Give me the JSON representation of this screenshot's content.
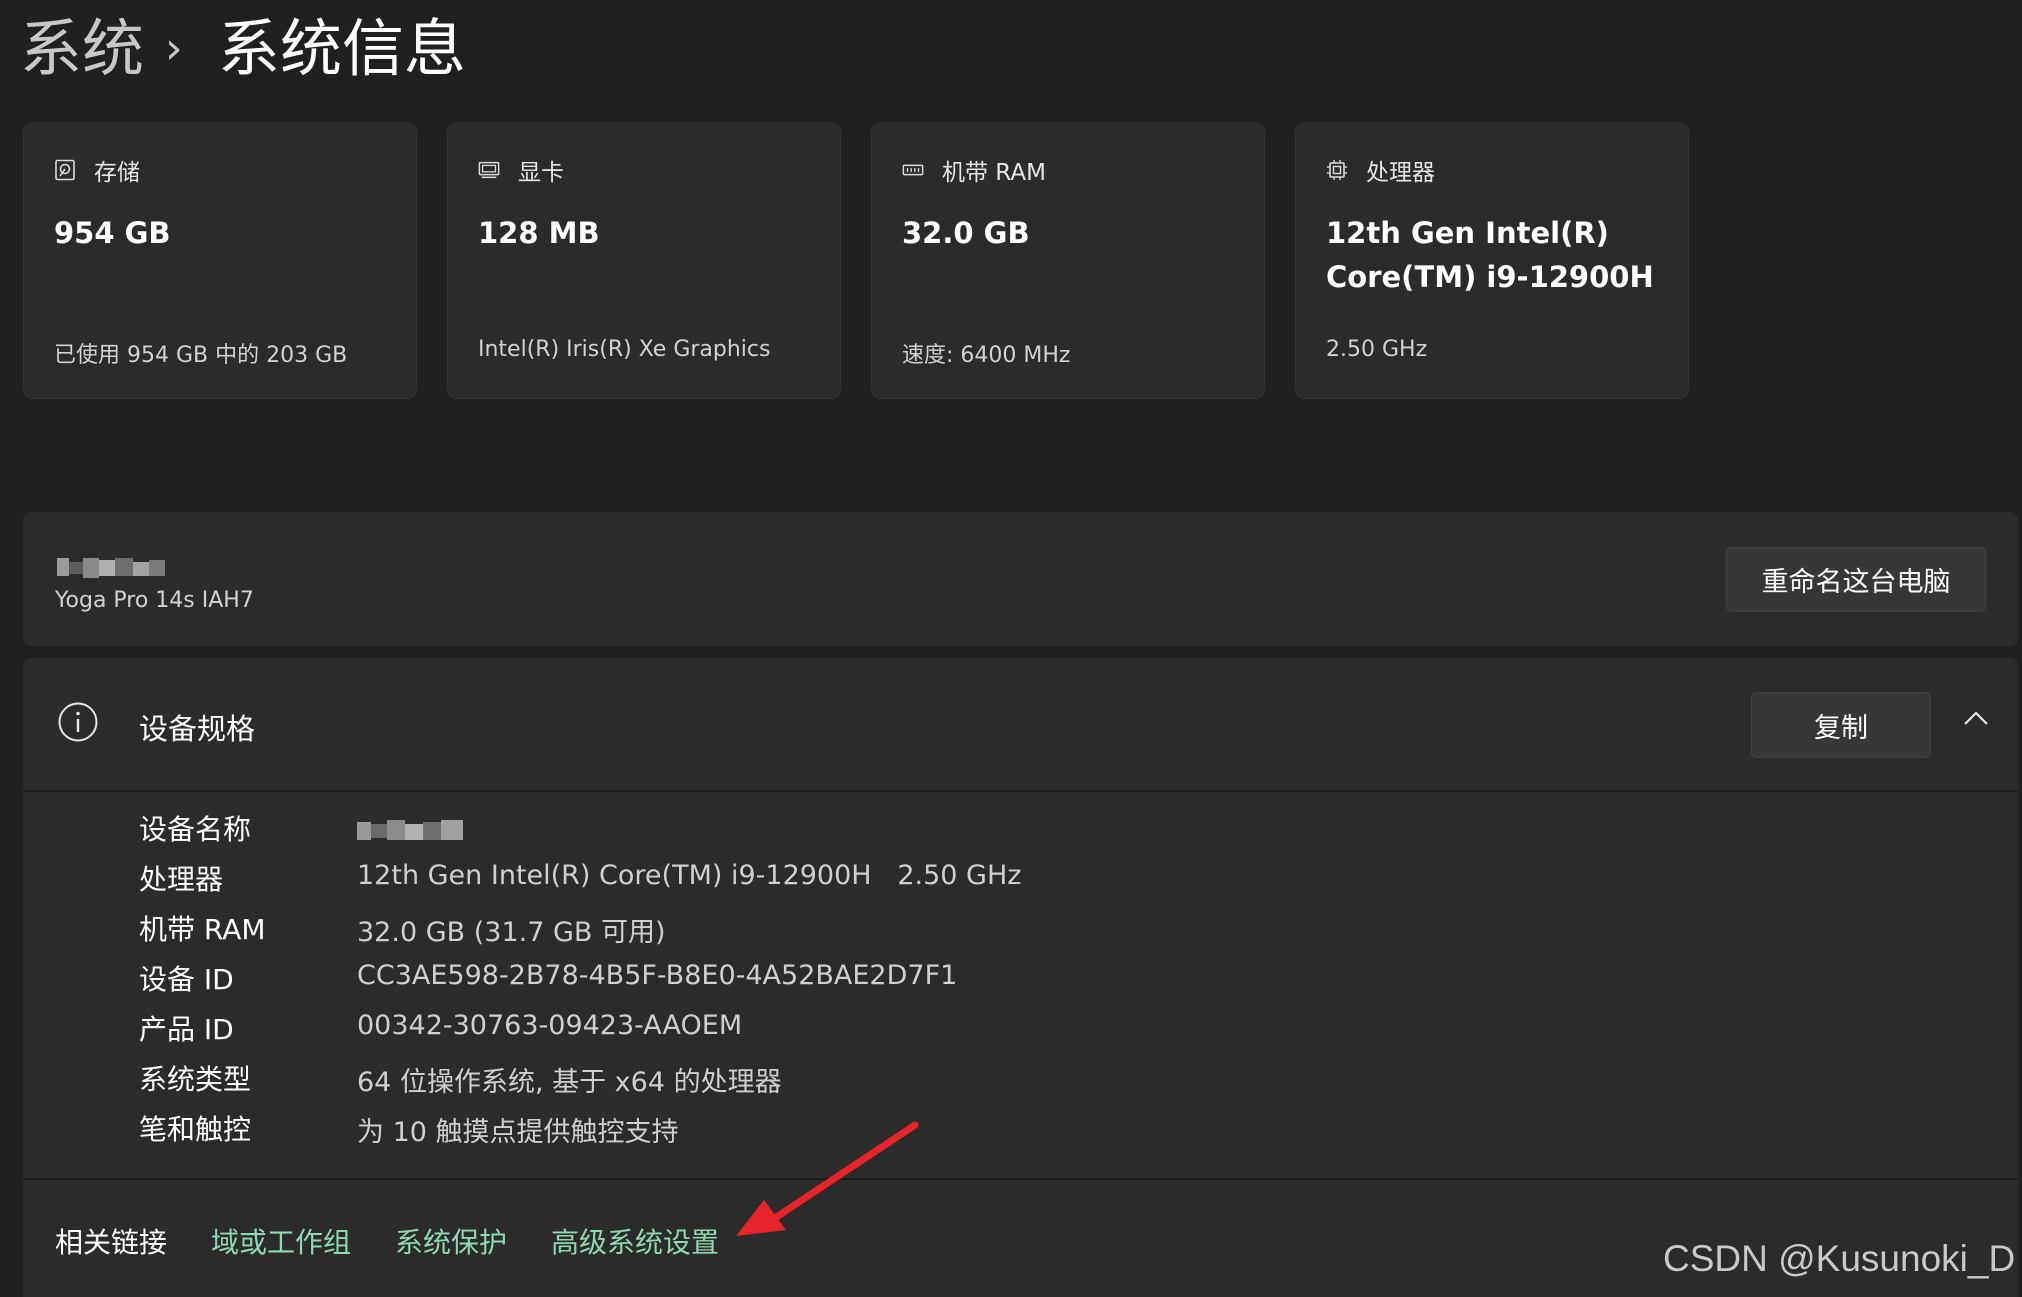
{
  "breadcrumb": {
    "root": "系统",
    "separator": "›",
    "current": "系统信息"
  },
  "cards": [
    {
      "icon": "storage-icon",
      "label": "存储",
      "value": "954 GB",
      "sub": "已使用 954 GB 中的 203 GB"
    },
    {
      "icon": "display-adapter-icon",
      "label": "显卡",
      "value": "128 MB",
      "sub": "Intel(R) Iris(R) Xe Graphics"
    },
    {
      "icon": "ram-icon",
      "label": "机带 RAM",
      "value": "32.0 GB",
      "sub": "速度: 6400 MHz"
    },
    {
      "icon": "processor-icon",
      "label": "处理器",
      "value": "12th Gen Intel(R) Core(TM) i9-12900H",
      "sub": "2.50 GHz"
    }
  ],
  "computer": {
    "model": "Yoga Pro 14s IAH7",
    "rename_label": "重命名这台电脑"
  },
  "device_specs": {
    "title": "设备规格",
    "copy_label": "复制",
    "rows": [
      {
        "key": "设备名称",
        "value": ""
      },
      {
        "key": "处理器",
        "value": "12th Gen Intel(R) Core(TM) i9-12900H   2.50 GHz"
      },
      {
        "key": "机带 RAM",
        "value": "32.0 GB (31.7 GB 可用)"
      },
      {
        "key": "设备 ID",
        "value": "CC3AE598-2B78-4B5F-B8E0-4A52BAE2D7F1"
      },
      {
        "key": "产品 ID",
        "value": "00342-30763-09423-AAOEM"
      },
      {
        "key": "系统类型",
        "value": "64 位操作系统, 基于 x64 的处理器"
      },
      {
        "key": "笔和触控",
        "value": "为 10 触摸点提供触控支持"
      }
    ]
  },
  "related_links": {
    "label": "相关链接",
    "links": [
      "域或工作组",
      "系统保护",
      "高级系统设置"
    ]
  },
  "annotation": {
    "arrow_color": "#e8242b"
  },
  "watermark": "CSDN @Kusunoki_D"
}
